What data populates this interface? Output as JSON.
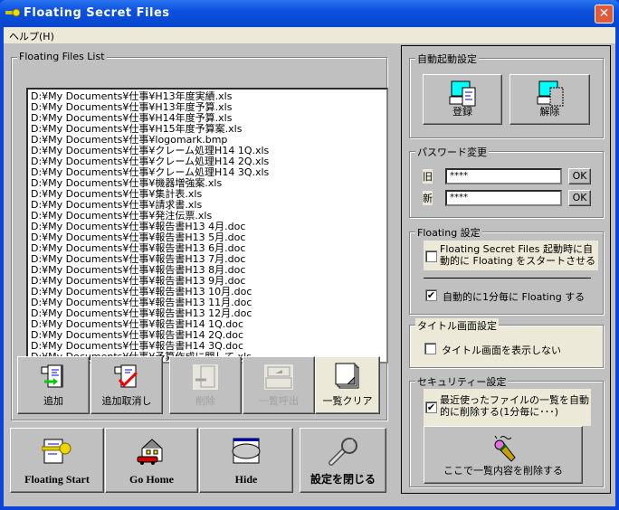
{
  "window": {
    "title": "Floating Secret Files",
    "close": "✕"
  },
  "menu": {
    "help": "ヘルプ(H)"
  },
  "files": {
    "group_label": "Floating Files List",
    "items": [
      "D:¥My Documents¥仕事¥H13年度実績.xls",
      "D:¥My Documents¥仕事¥H13年度予算.xls",
      "D:¥My Documents¥仕事¥H14年度予算.xls",
      "D:¥My Documents¥仕事¥H15年度予算案.xls",
      "D:¥My Documents¥仕事¥logomark.bmp",
      "D:¥My Documents¥仕事¥クレーム処理H14 1Q.xls",
      "D:¥My Documents¥仕事¥クレーム処理H14 2Q.xls",
      "D:¥My Documents¥仕事¥クレーム処理H14 3Q.xls",
      "D:¥My Documents¥仕事¥機器増強案.xls",
      "D:¥My Documents¥仕事¥集計表.xls",
      "D:¥My Documents¥仕事¥請求書.xls",
      "D:¥My Documents¥仕事¥発注伝票.xls",
      "D:¥My Documents¥仕事¥報告書H13 4月.doc",
      "D:¥My Documents¥仕事¥報告書H13 5月.doc",
      "D:¥My Documents¥仕事¥報告書H13 6月.doc",
      "D:¥My Documents¥仕事¥報告書H13 7月.doc",
      "D:¥My Documents¥仕事¥報告書H13 8月.doc",
      "D:¥My Documents¥仕事¥報告書H13 9月.doc",
      "D:¥My Documents¥仕事¥報告書H13 10月.doc",
      "D:¥My Documents¥仕事¥報告書H13 11月.doc",
      "D:¥My Documents¥仕事¥報告書H13 12月.doc",
      "D:¥My Documents¥仕事¥報告書H14 1Q.doc",
      "D:¥My Documents¥仕事¥報告書H14 2Q.doc",
      "D:¥My Documents¥仕事¥報告書H14 3Q.doc",
      "D:¥My Documents¥仕事¥予算作成に関して.xls"
    ]
  },
  "toolbar": {
    "add": "追加",
    "add_cancel": "追加取消し",
    "delete": "削除",
    "list_call": "一覧呼出",
    "list_clear": "一覧クリア"
  },
  "actions": {
    "floating_start": "Floating Start",
    "go_home": "Go Home",
    "hide": "Hide",
    "close_settings": "設定を閉じる"
  },
  "autostart": {
    "label": "自動起動設定",
    "register": "登録",
    "unregister": "解除"
  },
  "password": {
    "label": "パスワード変更",
    "old_label": "旧",
    "old_value": "****",
    "new_label": "新",
    "new_value": "****",
    "ok": "OK"
  },
  "floating": {
    "label": "Floating 設定",
    "start_on_launch": "Floating Secret Files 起動時に自動的に Floating をスタートさせる",
    "start_on_launch_checked": false,
    "every_minute": "自動的に1分毎に Floating する",
    "every_minute_checked": true
  },
  "title_screen": {
    "label": "タイトル画面設定",
    "hide": "タイトル画面を表示しない",
    "hide_checked": false
  },
  "security": {
    "label": "セキュリティー設定",
    "auto_delete": "最近使ったファイルの一覧を自動的に削除する(1分毎に･･･)",
    "auto_delete_checked": true,
    "delete_now": "ここで一覧内容を削除する"
  },
  "colors": {
    "titlebar": "#0a50e0",
    "face": "#c0c0c0",
    "beige": "#ece9d8"
  }
}
